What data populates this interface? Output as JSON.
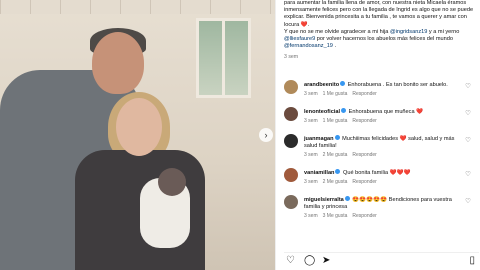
{
  "photo": {
    "stamp_text": "",
    "next_glyph": "›"
  },
  "caption": {
    "text": "para aumentar la familia llena de amor, con nuestra nieta Micaela éramos inmensamente felices pero con la llegada de Ingrid es algo que no se puede explicar. Bienvenida princesita a tu familia , te vamos a querer y amar con locura ❤️.",
    "line2_prefix": "Y que no se me olvide agradecer a mi hija ",
    "mention1": "@ingridsanz19",
    "line2_mid": " y a mi yerno ",
    "mention2": "@lliesfaure9",
    "line2_suffix": " por volver hacernos los abuelos más felices del mundo ",
    "mention3": "@fernandosanz_19",
    "line2_end": " .",
    "time": "3 sem"
  },
  "comments": [
    {
      "user": "arandbeenito",
      "text": "Enhorabuena . Es tan bonito ser abuelo.",
      "time": "3 sem",
      "likes": "1 Me gusta",
      "reply": "Responder",
      "avatar_color": "#b08a5a"
    },
    {
      "user": "lenonteoficial",
      "text": "Enhorabuena que muñeca ❤️",
      "time": "3 sem",
      "likes": "1 Me gusta",
      "reply": "Responder",
      "avatar_color": "#6b4b3e"
    },
    {
      "user": "juanmagan",
      "text": "Muchiiimas felicidades ❤️ salud, salud y más salud familia!",
      "time": "3 sem",
      "likes": "2 Me gusta",
      "reply": "Responder",
      "avatar_color": "#2b2b2b"
    },
    {
      "user": "vaniamillan",
      "text": "Qué bonita familia ❤️❤️❤️",
      "time": "3 sem",
      "likes": "2 Me gusta",
      "reply": "Responder",
      "avatar_color": "#a05a3c"
    },
    {
      "user": "miguelsierralta",
      "text": "😍😍😍😍😍 Bendiciones para vuestra familia y princesa",
      "time": "3 sem",
      "likes": "3 Me gusta",
      "reply": "Responder",
      "avatar_color": "#7a6a5c"
    }
  ],
  "actions": {
    "like_icon": "♡",
    "comment_icon": "◯",
    "share_icon": "➤",
    "save_icon": "▯"
  },
  "colors": {
    "link": "#00376b",
    "muted": "#737373",
    "verified": "#3897f0",
    "heart": "#e0245e"
  }
}
